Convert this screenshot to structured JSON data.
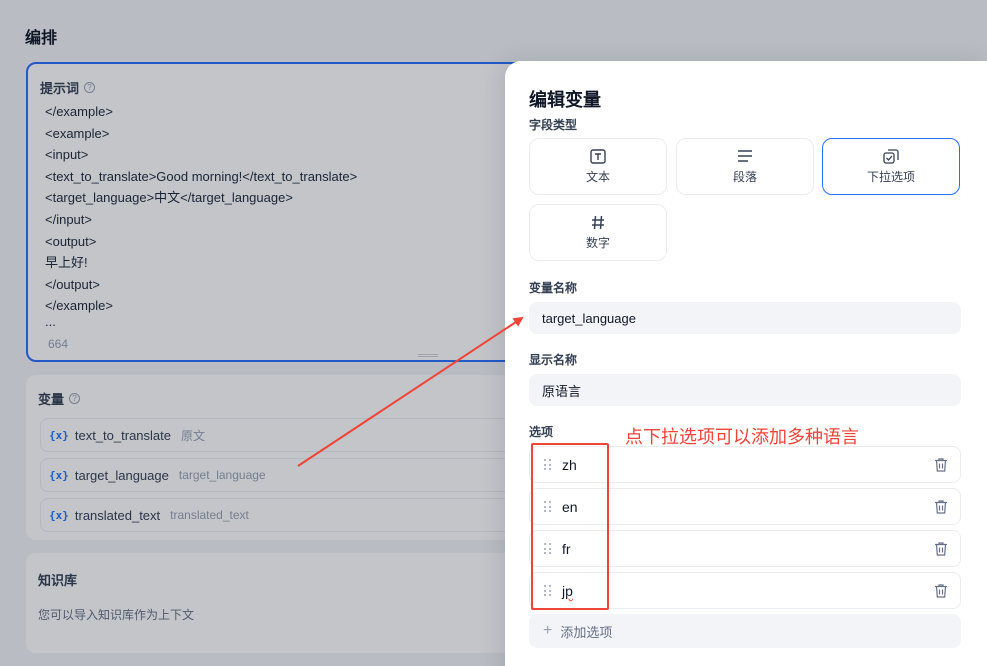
{
  "page": {
    "title": "编排"
  },
  "prompt": {
    "title": "提示词",
    "lines": [
      "</example>",
      "<example>",
      "<input>",
      "<text_to_translate>Good morning!</text_to_translate>",
      "<target_language>中文</target_language>",
      "</input>",
      "<output>",
      "早上好!",
      "</output>",
      "</example>",
      "..."
    ],
    "char_count": "664"
  },
  "variables": {
    "title": "变量",
    "items": [
      {
        "key": "text_to_translate",
        "label": "原文"
      },
      {
        "key": "target_language",
        "label": "target_language"
      },
      {
        "key": "translated_text",
        "label": "translated_text"
      }
    ],
    "icon": "{x}"
  },
  "knowledge": {
    "title": "知识库",
    "description": "您可以导入知识库作为上下文"
  },
  "modal": {
    "title": "编辑变量",
    "field_type_label": "字段类型",
    "types": [
      {
        "label": "文本",
        "icon": "text-type-icon",
        "selected": false
      },
      {
        "label": "段落",
        "icon": "paragraph-icon",
        "selected": false
      },
      {
        "label": "下拉选项",
        "icon": "select-checkbox-icon",
        "selected": true
      },
      {
        "label": "数字",
        "icon": "hash-icon",
        "selected": false
      }
    ],
    "var_name_label": "变量名称",
    "var_name_value": "target_language",
    "display_name_label": "显示名称",
    "display_name_value": "原语言",
    "options_label": "选项",
    "options": [
      "zh",
      "en",
      "fr",
      "jp"
    ],
    "add_option_label": "添加选项"
  },
  "annotation": {
    "text": "点下拉选项可以添加多种语言",
    "color": "#f04438"
  },
  "colors": {
    "accent": "#2970ff",
    "annotation": "#f04438"
  }
}
